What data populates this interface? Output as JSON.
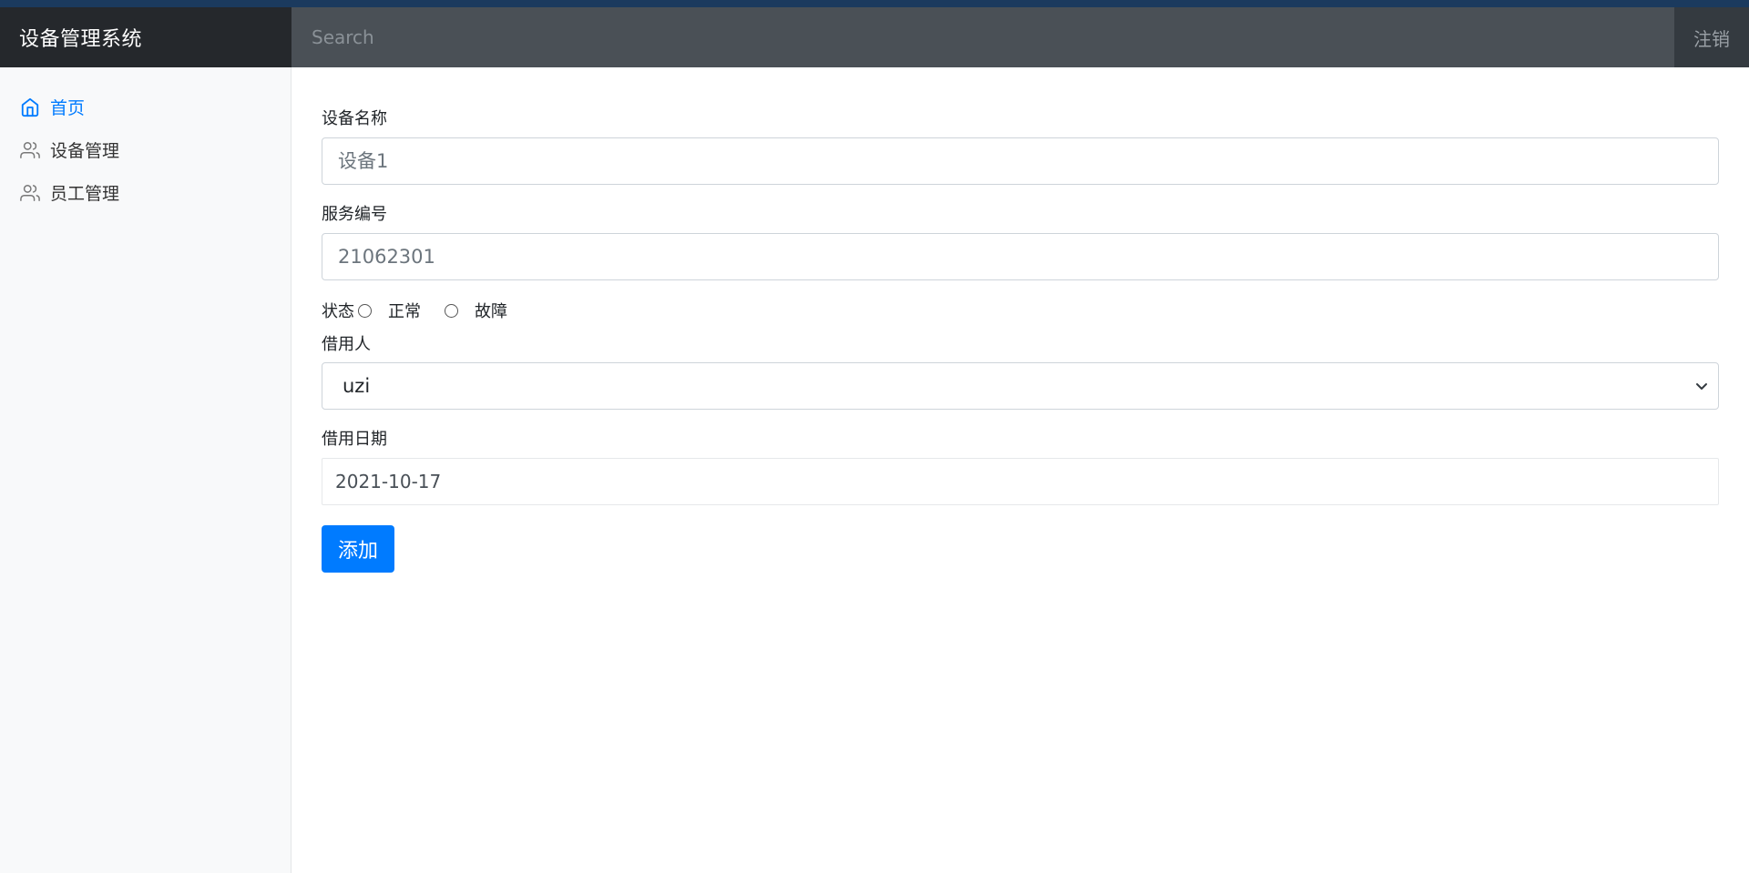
{
  "navbar": {
    "brand": "设备管理系统",
    "search_placeholder": "Search",
    "logout_label": "注销"
  },
  "sidebar": {
    "items": [
      {
        "label": "首页",
        "icon": "home-icon",
        "active": true
      },
      {
        "label": "设备管理",
        "icon": "users-icon",
        "active": false
      },
      {
        "label": "员工管理",
        "icon": "users-icon",
        "active": false
      }
    ]
  },
  "form": {
    "device_name": {
      "label": "设备名称",
      "placeholder": "设备1"
    },
    "service_no": {
      "label": "服务编号",
      "placeholder": "21062301"
    },
    "status": {
      "label": "状态",
      "options": [
        "正常",
        "故障"
      ]
    },
    "borrower": {
      "label": "借用人",
      "selected": "uzi"
    },
    "borrow_date": {
      "label": "借用日期",
      "value": "2021-10-17"
    },
    "submit_label": "添加"
  },
  "colors": {
    "primary": "#007bff",
    "navbar_bg": "#343a40",
    "brand_bg": "#25282c",
    "sidebar_bg": "#f8f9fa"
  }
}
